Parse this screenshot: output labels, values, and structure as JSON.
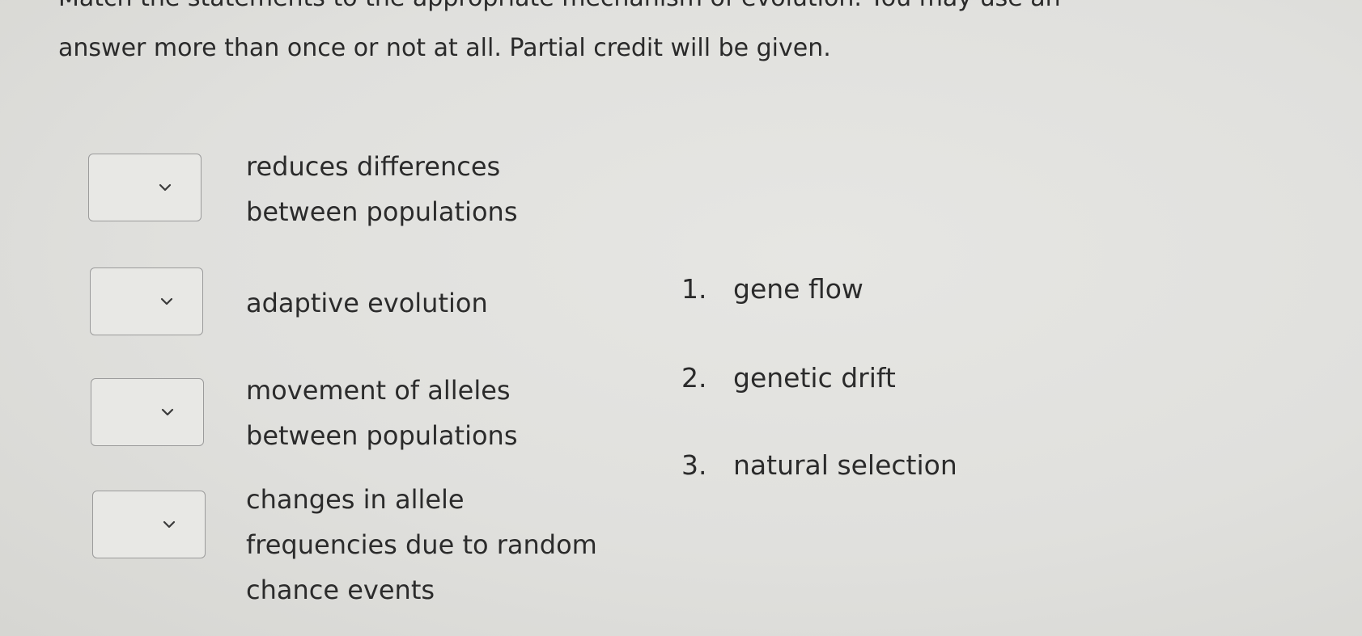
{
  "instructions": {
    "line1": "Match the statements to the appropriate mechanism of evolution. You may use an",
    "line2": "answer more than once or not at all. Partial credit will be given."
  },
  "statements": [
    {
      "lines": [
        "reduces differences",
        "between populations"
      ],
      "selected": ""
    },
    {
      "lines": [
        "adaptive evolution"
      ],
      "selected": ""
    },
    {
      "lines": [
        "movement of alleles",
        "between populations"
      ],
      "selected": ""
    },
    {
      "lines": [
        "changes in allele",
        "frequencies due to random",
        "chance events"
      ],
      "selected": ""
    }
  ],
  "dropdown_icon": "chevron-down-icon",
  "answers": [
    {
      "number": "1.",
      "label": "gene flow"
    },
    {
      "number": "2.",
      "label": "genetic drift"
    },
    {
      "number": "3.",
      "label": "natural selection"
    }
  ]
}
